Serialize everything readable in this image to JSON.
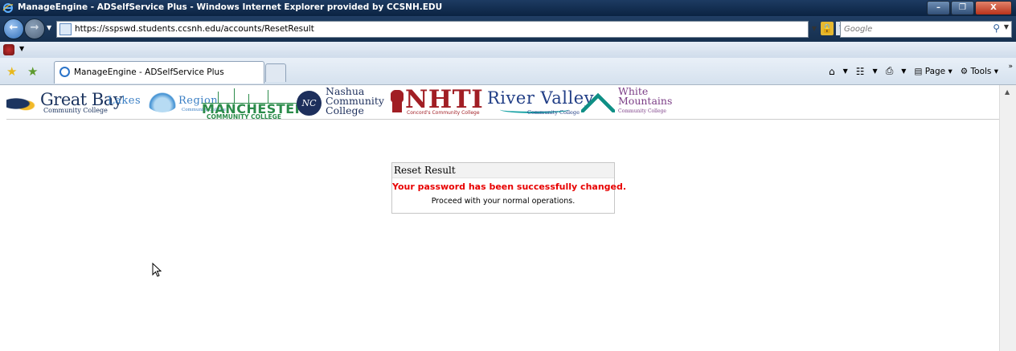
{
  "window": {
    "title": "ManageEngine - ADSelfService Plus - Windows Internet Explorer provided by CCSNH.EDU",
    "minimize": "–",
    "maximize": "❐",
    "close": "X"
  },
  "addressbar": {
    "url": "https://sspswd.students.ccsnh.edu/accounts/ResetResult",
    "search_placeholder": "Google"
  },
  "tabs": [
    {
      "label": "ManageEngine - ADSelfService Plus"
    }
  ],
  "commandbar": {
    "page_label": "Page",
    "tools_label": "Tools"
  },
  "banner": {
    "great_bay": {
      "name": "Great Bay",
      "sub": "Community College"
    },
    "lakes_region": {
      "name_a": "Lakes",
      "name_b": "Region",
      "sub": "Community College"
    },
    "manchester": {
      "name": "MANCHESTER",
      "sub": "COMMUNITY COLLEGE"
    },
    "nashua": {
      "mark": "NC",
      "line1": "Nashua",
      "line2": "Community",
      "line3": "College"
    },
    "nhti": {
      "name": "NHTI",
      "sub": "Concord's Community College"
    },
    "river_valley": {
      "name": "River Valley",
      "sub": "Community College"
    },
    "white_mountains": {
      "line1": "White",
      "line2": "Mountains",
      "sub": "Community College"
    }
  },
  "result": {
    "header": "Reset Result",
    "message": "Your password has been successfully changed.",
    "detail": "Proceed with your normal operations."
  }
}
